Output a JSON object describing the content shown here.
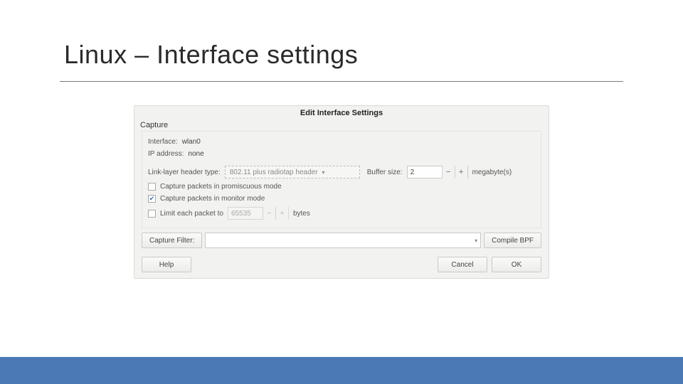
{
  "slide": {
    "title": "Linux – Interface settings"
  },
  "dialog": {
    "title": "Edit Interface Settings",
    "group_label": "Capture",
    "interface_label": "Interface:",
    "interface_value": "wlan0",
    "ip_label": "IP address:",
    "ip_value": "none",
    "linklayer_label": "Link-layer header type:",
    "linklayer_value": "802.11 plus radiotap header",
    "buffer_label": "Buffer size:",
    "buffer_value": "2",
    "buffer_unit": "megabyte(s)",
    "promisc_label": "Capture packets in promiscuous mode",
    "promisc_checked": false,
    "monitor_label": "Capture packets in monitor mode",
    "monitor_checked": true,
    "limit_label": "Limit each packet to",
    "limit_checked": false,
    "limit_value": "65535",
    "limit_unit": "bytes",
    "capture_filter_btn": "Capture Filter:",
    "compile_bpf_btn": "Compile BPF",
    "help_btn": "Help",
    "cancel_btn": "Cancel",
    "ok_btn": "OK"
  }
}
